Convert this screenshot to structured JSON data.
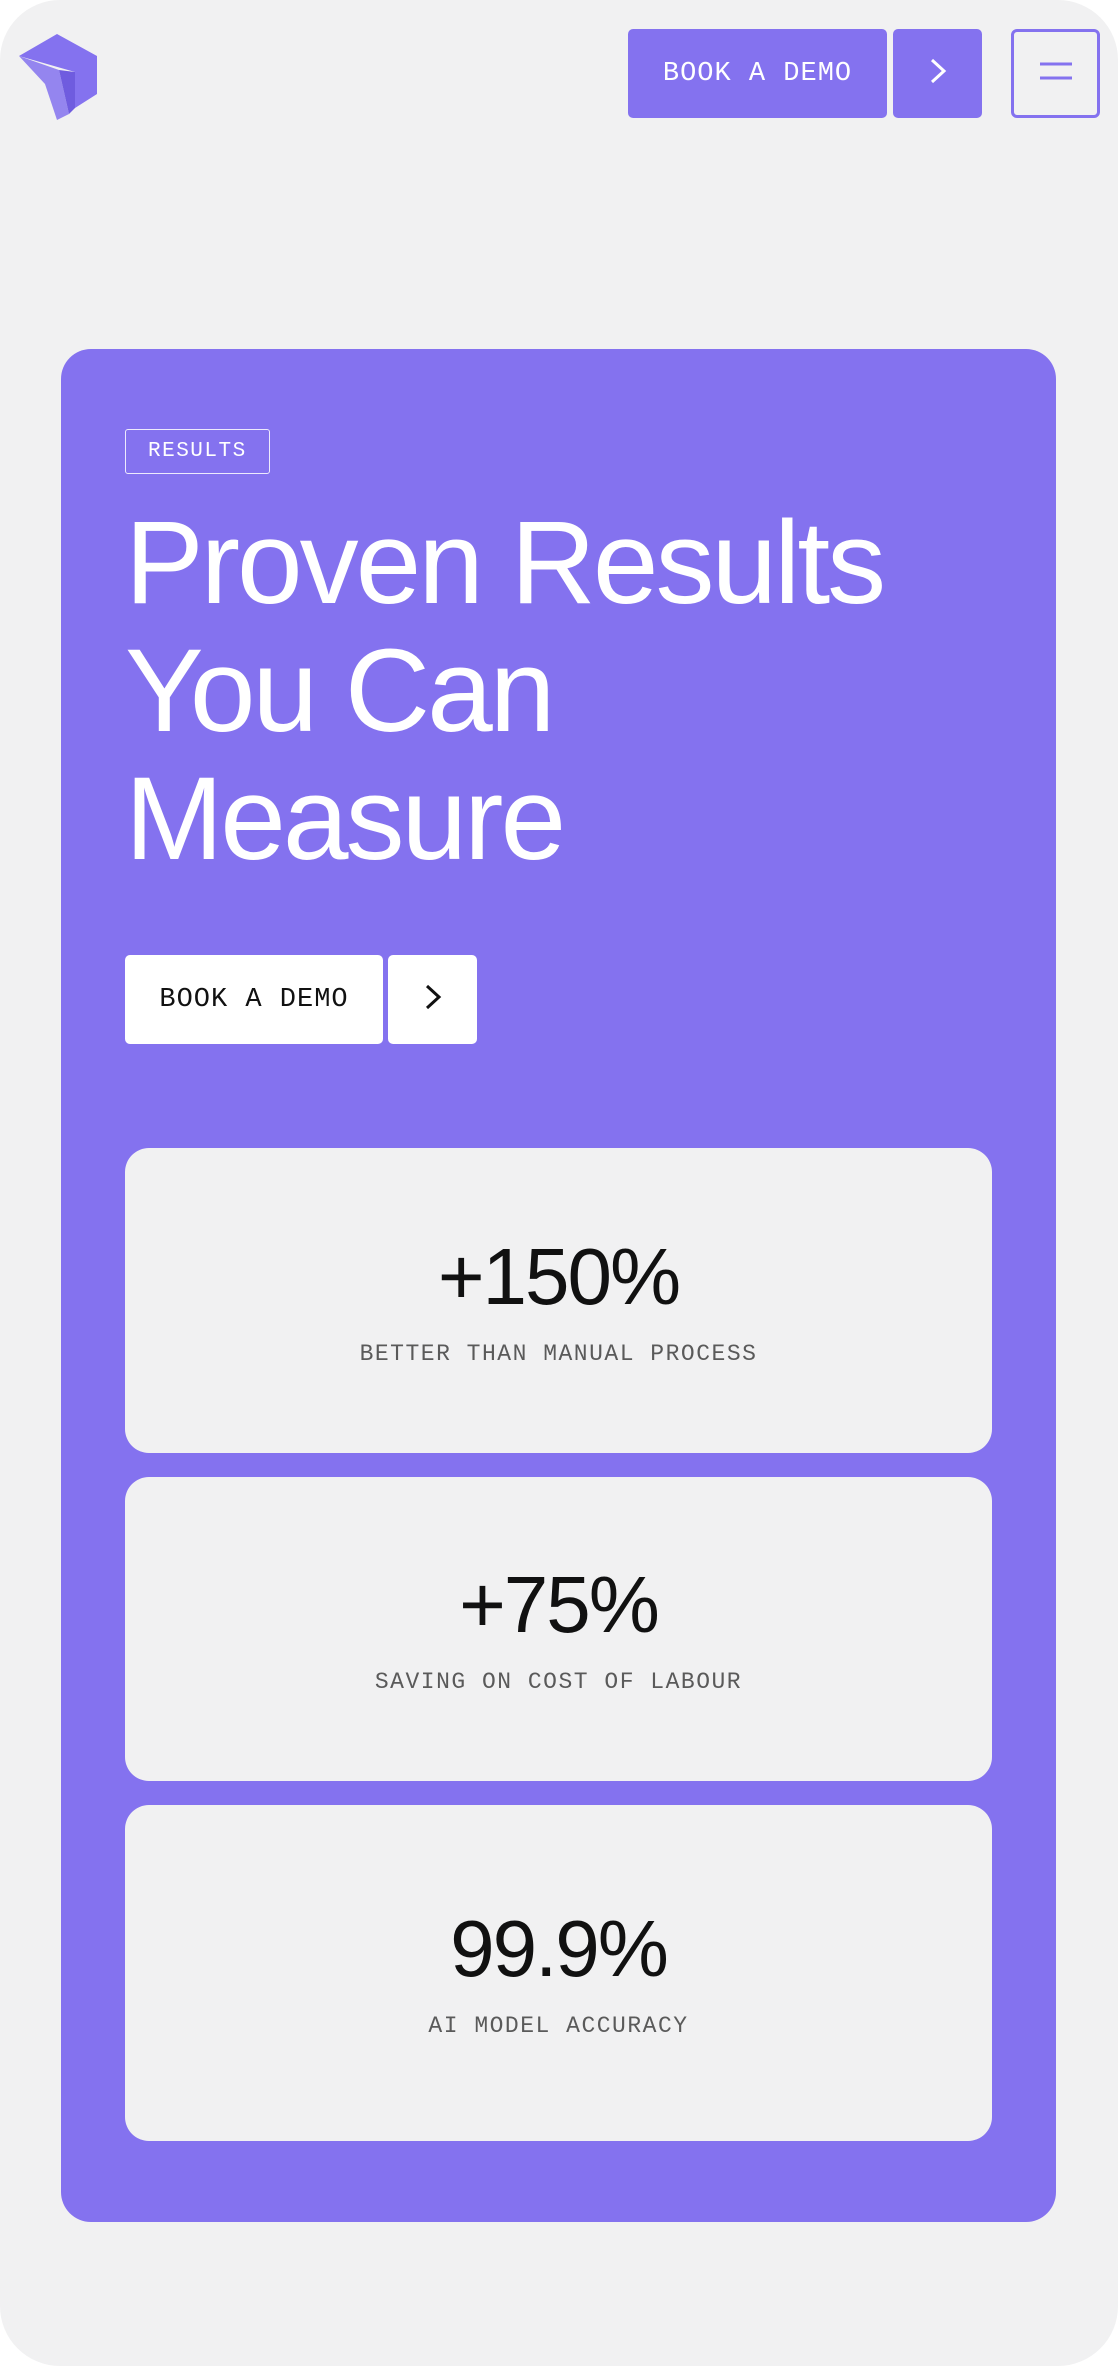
{
  "header": {
    "book_demo_label": "BOOK A DEMO",
    "arrow_icon": "chevron-right-icon",
    "menu_icon": "menu-icon",
    "logo_icon": "brand-logo-icon"
  },
  "hero": {
    "badge": "RESULTS",
    "heading_lines": [
      "Proven Results",
      "You Can",
      "Measure"
    ],
    "book_demo_label": "BOOK A DEMO"
  },
  "stats": [
    {
      "value": "+150%",
      "label": "BETTER THAN MANUAL PROCESS"
    },
    {
      "value": "+75%",
      "label": "SAVING ON COST OF LABOUR"
    },
    {
      "value": "99.9%",
      "label": "AI MODEL ACCURACY"
    }
  ],
  "colors": {
    "accent": "#8472ef",
    "background": "#f1f1f2",
    "text": "#111111",
    "muted": "#5a5a5a"
  }
}
